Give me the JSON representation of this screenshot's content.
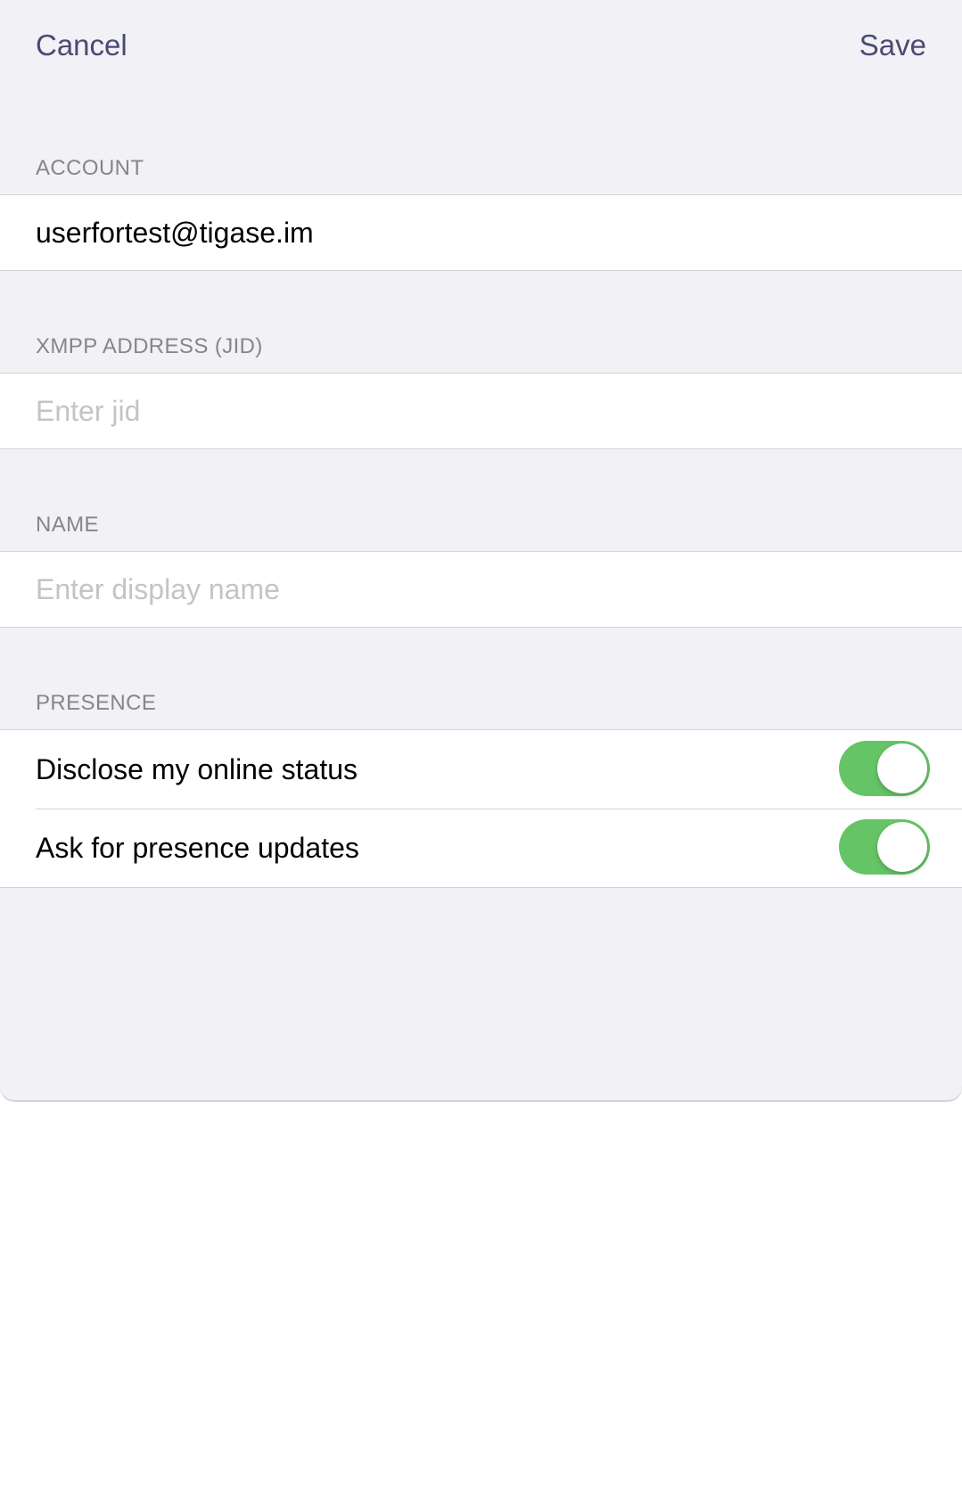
{
  "nav": {
    "cancel_label": "Cancel",
    "save_label": "Save"
  },
  "sections": {
    "account": {
      "header": "ACCOUNT",
      "value": "userfortest@tigase.im"
    },
    "jid": {
      "header": "XMPP ADDRESS (JID)",
      "value": "",
      "placeholder": "Enter jid"
    },
    "name": {
      "header": "NAME",
      "value": "",
      "placeholder": "Enter display name"
    },
    "presence": {
      "header": "PRESENCE",
      "items": [
        {
          "label": "Disclose my online status",
          "enabled": true
        },
        {
          "label": "Ask for presence updates",
          "enabled": true
        }
      ]
    }
  },
  "colors": {
    "accent": "#4a4a73",
    "toggle_on": "#65c466",
    "background": "#f1f1f6"
  }
}
